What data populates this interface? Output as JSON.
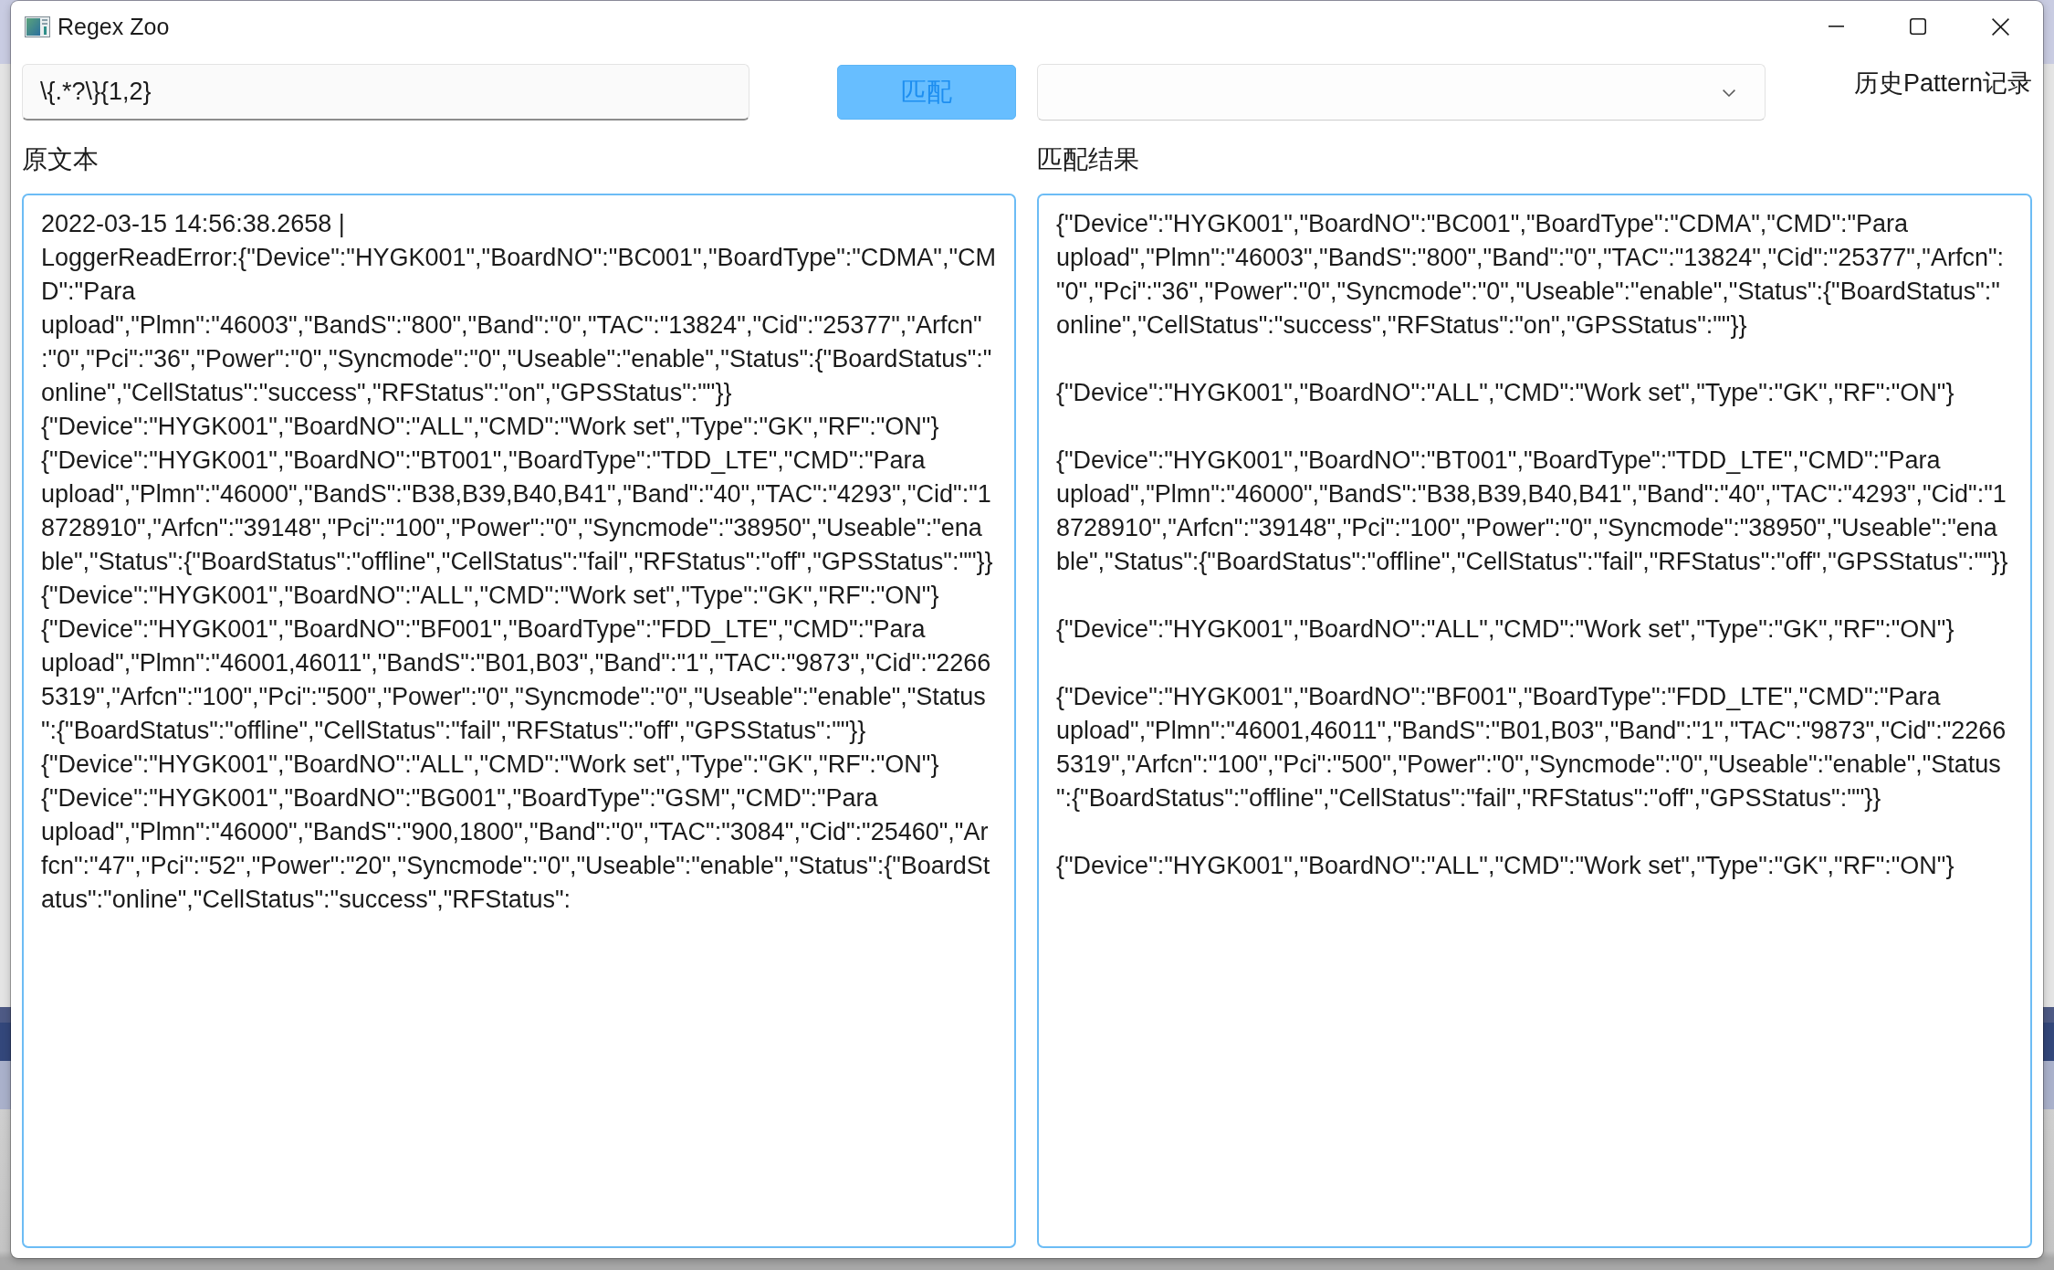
{
  "window": {
    "title": "Regex Zoo"
  },
  "pattern_field": {
    "value": "\\{.*?\\}{1,2}"
  },
  "match_button": {
    "label": "匹配"
  },
  "history_label": "历史Pattern记录",
  "source": {
    "label": "原文本",
    "lines": [
      "2022-03-15 14:56:38.2658 |",
      "LoggerReadError:{\"Device\":\"HYGK001\",\"BoardNO\":\"BC001\",\"BoardType\":\"CDMA\",\"CM",
      "D\":\"Para",
      "upload\",\"Plmn\":\"46003\",\"BandS\":\"800\",\"Band\":\"0\",\"TAC\":\"13824\",\"Cid\":\"25377\",\"Arfcn\"",
      ":\"0\",\"Pci\":\"36\",\"Power\":\"0\",\"Syncmode\":\"0\",\"Useable\":\"enable\",\"Status\":{\"BoardStatus\":\"",
      "online\",\"CellStatus\":\"success\",\"RFStatus\":\"on\",\"GPSStatus\":\"\"}}",
      "{\"Device\":\"HYGK001\",\"BoardNO\":\"ALL\",\"CMD\":\"Work set\",\"Type\":\"GK\",\"RF\":\"ON\"}",
      "{\"Device\":\"HYGK001\",\"BoardNO\":\"BT001\",\"BoardType\":\"TDD_LTE\",\"CMD\":\"Para",
      "upload\",\"Plmn\":\"46000\",\"BandS\":\"B38,B39,B40,B41\",\"Band\":\"40\",\"TAC\":\"4293\",\"Cid\":\"1",
      "8728910\",\"Arfcn\":\"39148\",\"Pci\":\"100\",\"Power\":\"0\",\"Syncmode\":\"38950\",\"Useable\":\"ena",
      "ble\",\"Status\":{\"BoardStatus\":\"offline\",\"CellStatus\":\"fail\",\"RFStatus\":\"off\",\"GPSStatus\":\"\"}}",
      "{\"Device\":\"HYGK001\",\"BoardNO\":\"ALL\",\"CMD\":\"Work set\",\"Type\":\"GK\",\"RF\":\"ON\"}",
      "{\"Device\":\"HYGK001\",\"BoardNO\":\"BF001\",\"BoardType\":\"FDD_LTE\",\"CMD\":\"Para",
      "upload\",\"Plmn\":\"46001,46011\",\"BandS\":\"B01,B03\",\"Band\":\"1\",\"TAC\":\"9873\",\"Cid\":\"2266",
      "5319\",\"Arfcn\":\"100\",\"Pci\":\"500\",\"Power\":\"0\",\"Syncmode\":\"0\",\"Useable\":\"enable\",\"Status",
      "\":{\"BoardStatus\":\"offline\",\"CellStatus\":\"fail\",\"RFStatus\":\"off\",\"GPSStatus\":\"\"}}",
      "{\"Device\":\"HYGK001\",\"BoardNO\":\"ALL\",\"CMD\":\"Work set\",\"Type\":\"GK\",\"RF\":\"ON\"}",
      "{\"Device\":\"HYGK001\",\"BoardNO\":\"BG001\",\"BoardType\":\"GSM\",\"CMD\":\"Para",
      "upload\",\"Plmn\":\"46000\",\"BandS\":\"900,1800\",\"Band\":\"0\",\"TAC\":\"3084\",\"Cid\":\"25460\",\"Ar",
      "fcn\":\"47\",\"Pci\":\"52\",\"Power\":\"20\",\"Syncmode\":\"0\",\"Useable\":\"enable\",\"Status\":{\"BoardSt",
      "atus\":\"online\",\"CellStatus\":\"success\",\"RFStatus\":"
    ]
  },
  "result": {
    "label": "匹配结果",
    "matches": [
      {
        "lines": [
          "{\"Device\":\"HYGK001\",\"BoardNO\":\"BC001\",\"BoardType\":\"CDMA\",\"CMD\":\"Para",
          "upload\",\"Plmn\":\"46003\",\"BandS\":\"800\",\"Band\":\"0\",\"TAC\":\"13824\",\"Cid\":\"25377\",\"Arfcn\":",
          "\"0\",\"Pci\":\"36\",\"Power\":\"0\",\"Syncmode\":\"0\",\"Useable\":\"enable\",\"Status\":{\"BoardStatus\":\"",
          "online\",\"CellStatus\":\"success\",\"RFStatus\":\"on\",\"GPSStatus\":\"\"}}"
        ]
      },
      {
        "lines": [
          "{\"Device\":\"HYGK001\",\"BoardNO\":\"ALL\",\"CMD\":\"Work set\",\"Type\":\"GK\",\"RF\":\"ON\"}"
        ]
      },
      {
        "lines": [
          "{\"Device\":\"HYGK001\",\"BoardNO\":\"BT001\",\"BoardType\":\"TDD_LTE\",\"CMD\":\"Para",
          "upload\",\"Plmn\":\"46000\",\"BandS\":\"B38,B39,B40,B41\",\"Band\":\"40\",\"TAC\":\"4293\",\"Cid\":\"1",
          "8728910\",\"Arfcn\":\"39148\",\"Pci\":\"100\",\"Power\":\"0\",\"Syncmode\":\"38950\",\"Useable\":\"ena",
          "ble\",\"Status\":{\"BoardStatus\":\"offline\",\"CellStatus\":\"fail\",\"RFStatus\":\"off\",\"GPSStatus\":\"\"}}"
        ]
      },
      {
        "lines": [
          "{\"Device\":\"HYGK001\",\"BoardNO\":\"ALL\",\"CMD\":\"Work set\",\"Type\":\"GK\",\"RF\":\"ON\"}"
        ]
      },
      {
        "lines": [
          "{\"Device\":\"HYGK001\",\"BoardNO\":\"BF001\",\"BoardType\":\"FDD_LTE\",\"CMD\":\"Para",
          "upload\",\"Plmn\":\"46001,46011\",\"BandS\":\"B01,B03\",\"Band\":\"1\",\"TAC\":\"9873\",\"Cid\":\"2266",
          "5319\",\"Arfcn\":\"100\",\"Pci\":\"500\",\"Power\":\"0\",\"Syncmode\":\"0\",\"Useable\":\"enable\",\"Status",
          "\":{\"BoardStatus\":\"offline\",\"CellStatus\":\"fail\",\"RFStatus\":\"off\",\"GPSStatus\":\"\"}}"
        ]
      },
      {
        "lines": [
          "{\"Device\":\"HYGK001\",\"BoardNO\":\"ALL\",\"CMD\":\"Work set\",\"Type\":\"GK\",\"RF\":\"ON\"}"
        ]
      }
    ]
  }
}
